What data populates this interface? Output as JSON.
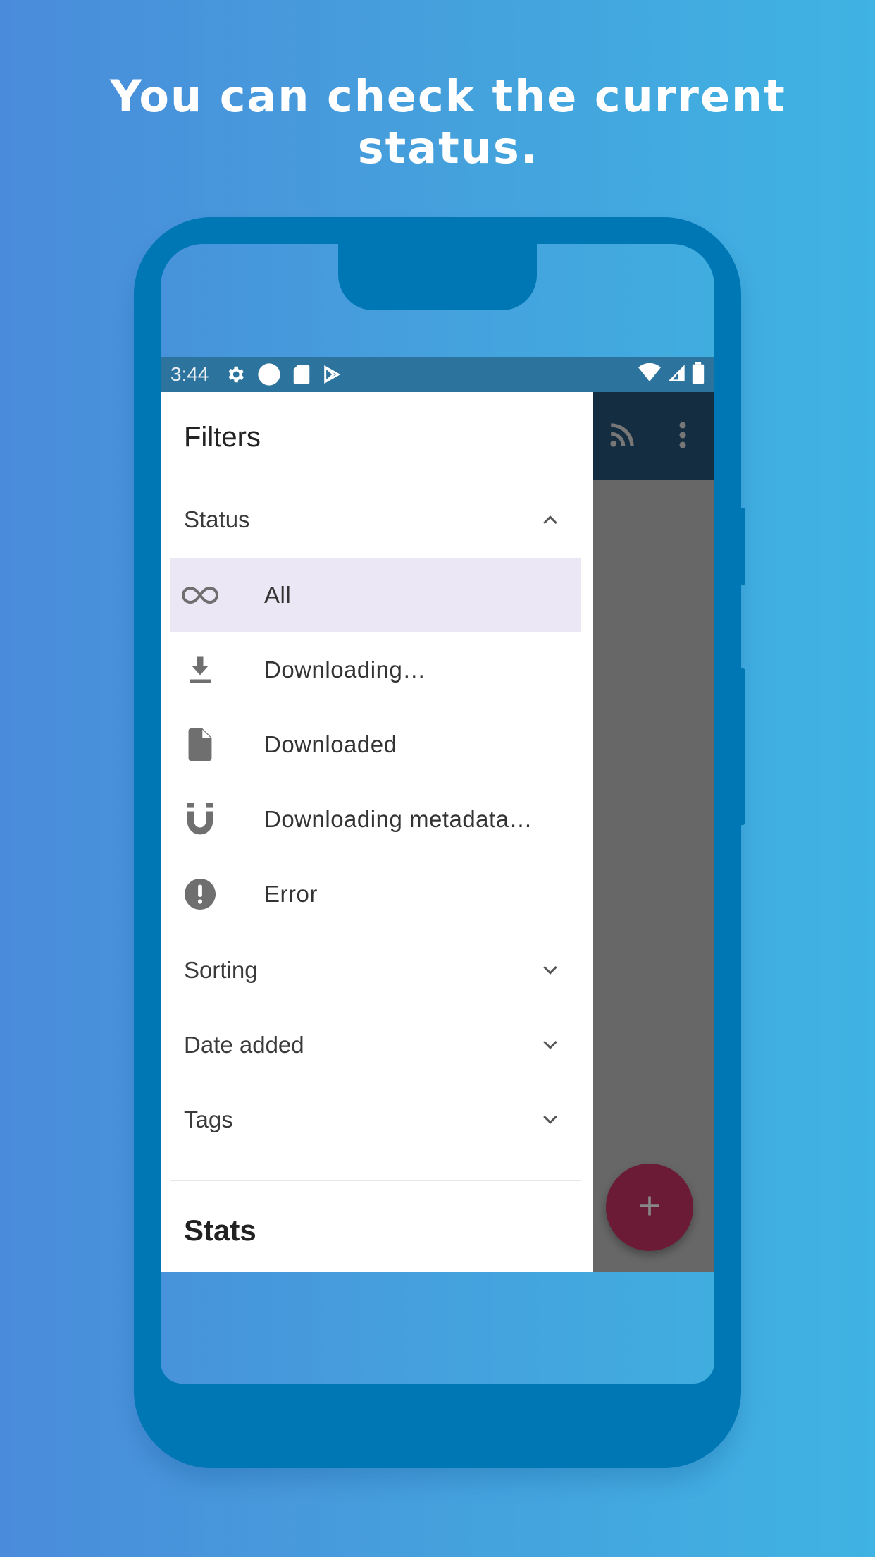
{
  "headline": "You can check the current status.",
  "status_bar": {
    "time": "3:44",
    "left_icons": [
      "settings-icon",
      "circle-icon",
      "sd-card-icon",
      "play-store-icon"
    ],
    "right_icons": [
      "wifi-icon",
      "signal-icon",
      "battery-icon"
    ]
  },
  "app_bar": {
    "icons": [
      "rss-feed-icon",
      "more-vert-icon"
    ]
  },
  "drawer": {
    "title": "Filters",
    "sections": [
      {
        "label": "Status",
        "expanded": true,
        "items": [
          {
            "label": "All",
            "icon": "infinity-icon",
            "selected": true
          },
          {
            "label": "Downloading…",
            "icon": "download-icon",
            "selected": false
          },
          {
            "label": "Downloaded",
            "icon": "file-icon",
            "selected": false
          },
          {
            "label": "Downloading metadata…",
            "icon": "magnet-icon",
            "selected": false
          },
          {
            "label": "Error",
            "icon": "error-icon",
            "selected": false
          }
        ]
      },
      {
        "label": "Sorting",
        "expanded": false
      },
      {
        "label": "Date added",
        "expanded": false
      },
      {
        "label": "Tags",
        "expanded": false
      }
    ],
    "stats_title": "Stats"
  },
  "fab": {
    "icon": "plus-icon",
    "color": "#6b1b36"
  },
  "colors": {
    "frame": "#0077b5",
    "status_bar": "#2c739d",
    "app_bar": "#152d40",
    "selected_item": "#ebe7f5",
    "scrim": "#676767"
  }
}
